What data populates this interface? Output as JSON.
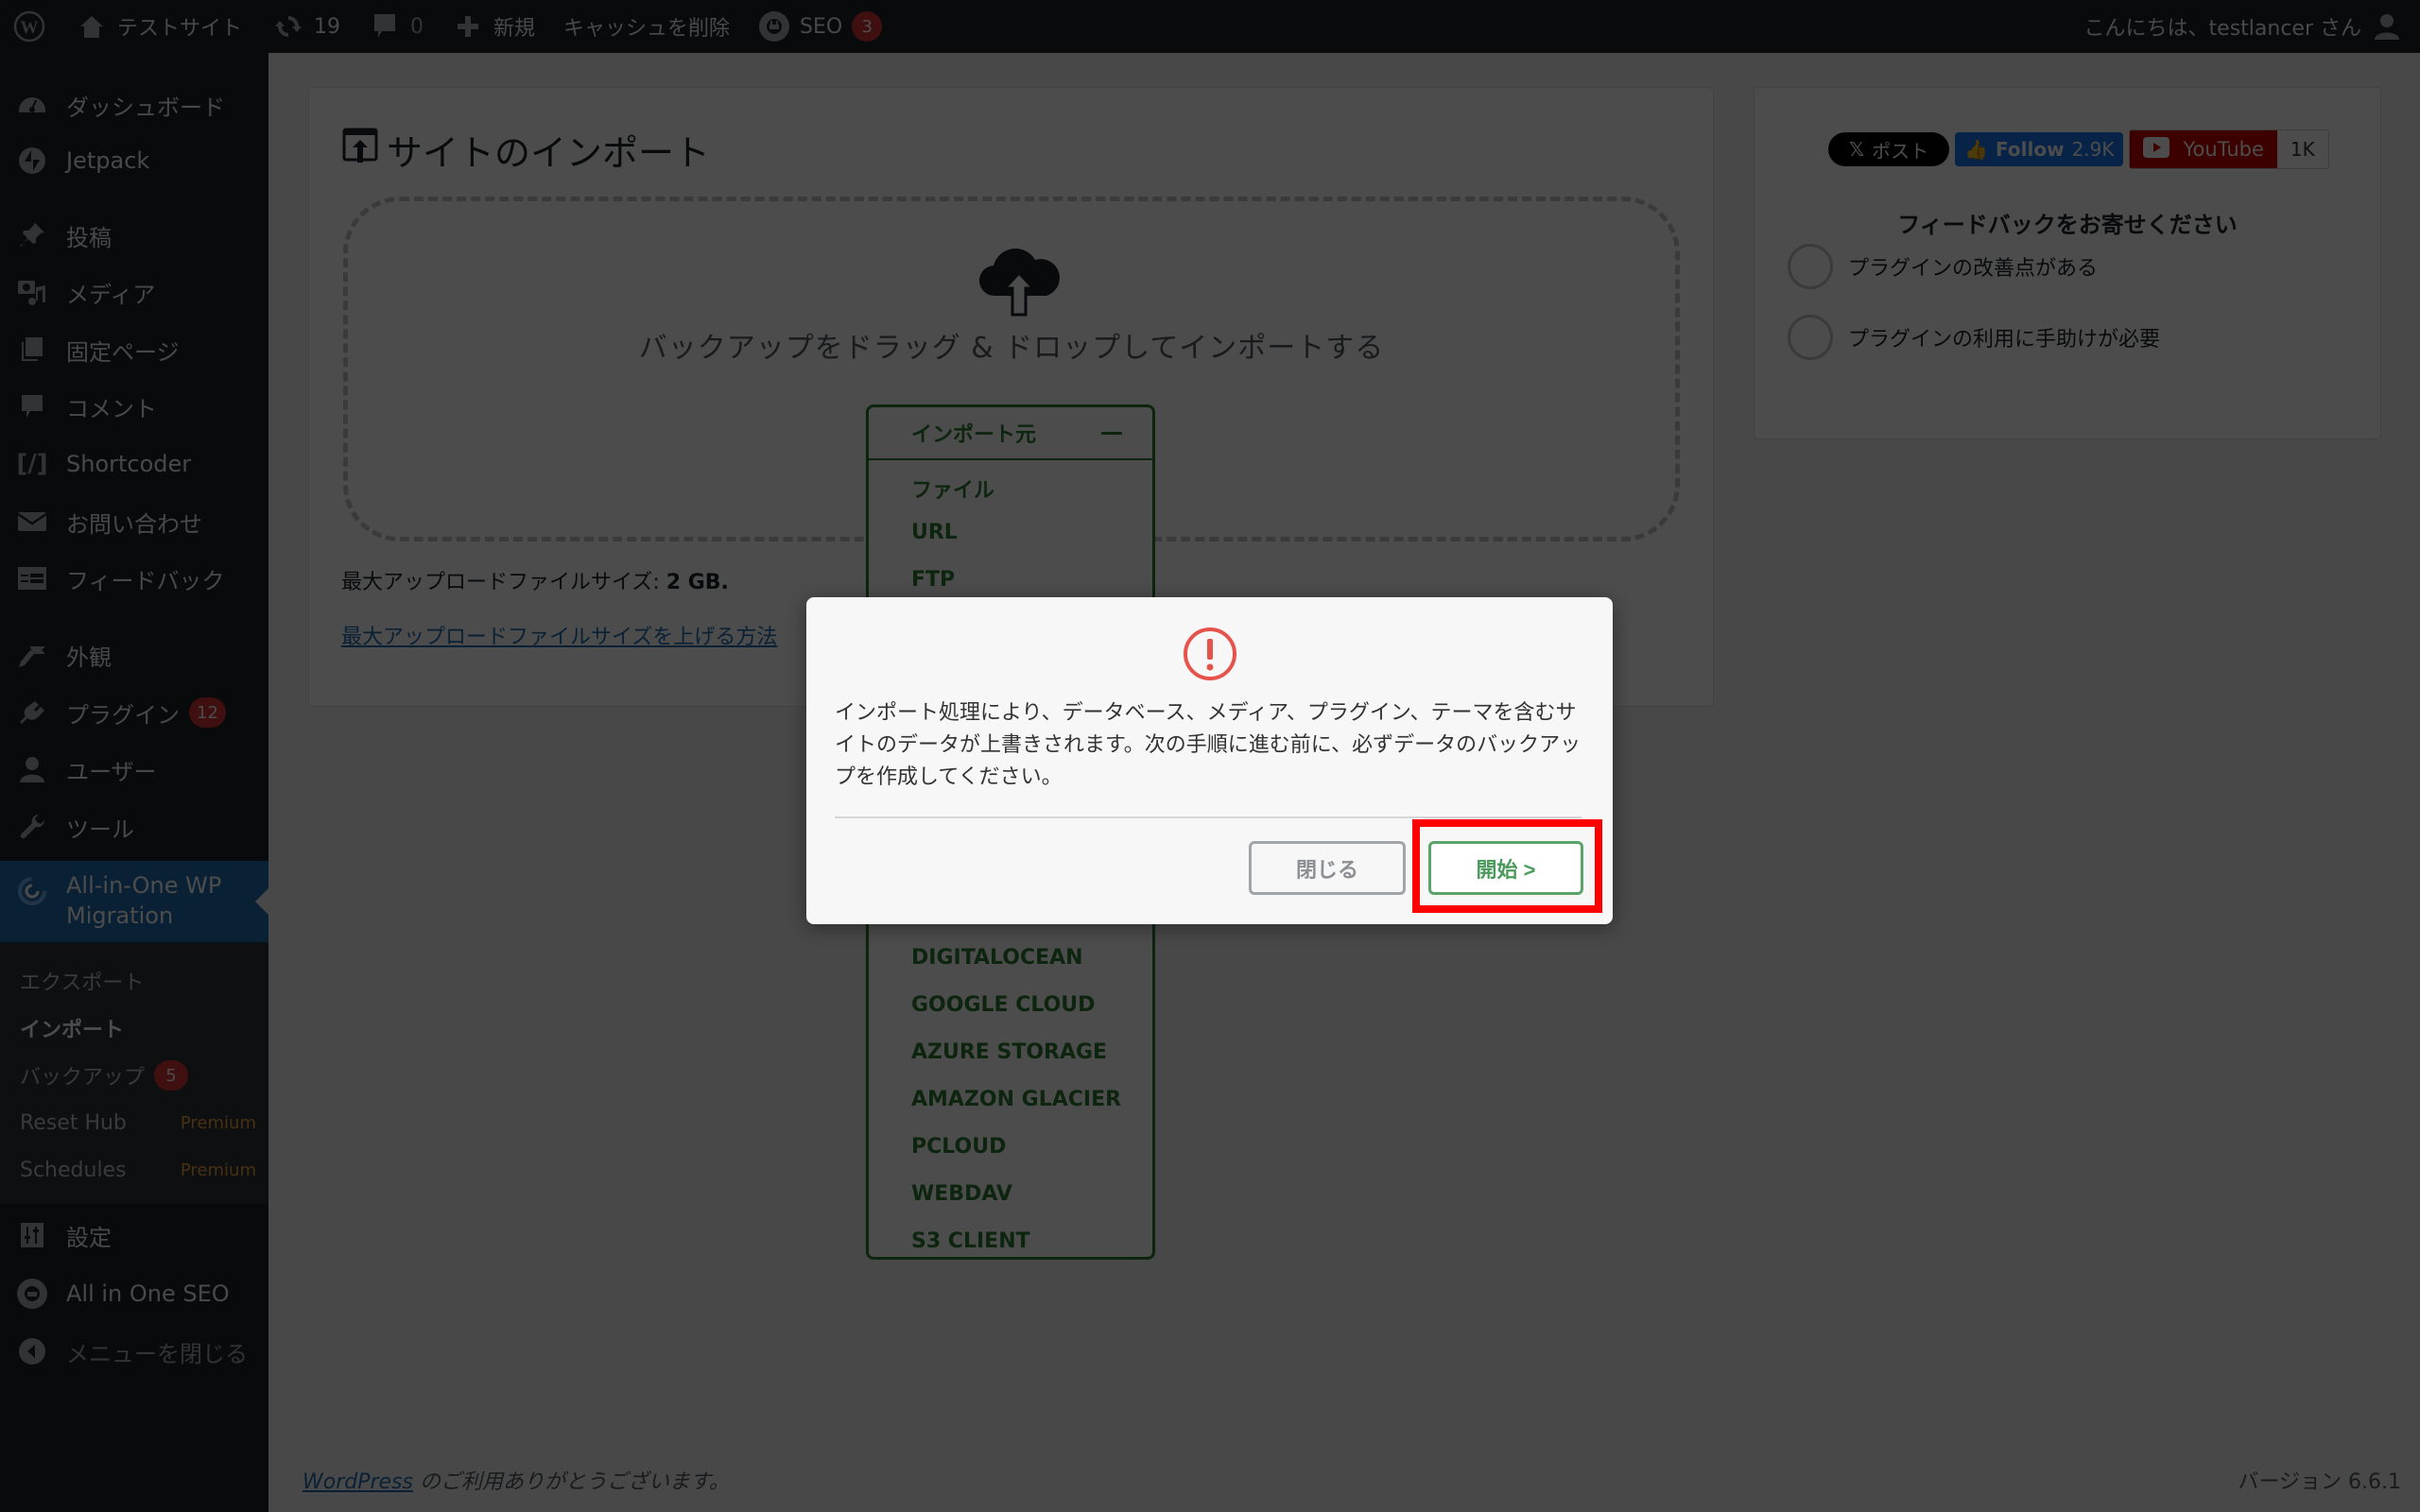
{
  "admin_bar": {
    "site_name": "テストサイト",
    "updates_count": "19",
    "comments_count": "0",
    "new_label": "新規",
    "clear_cache_label": "キャッシュを削除",
    "seo_label": "SEO",
    "seo_badge": "3",
    "greeting": "こんにちは、testlancer さん"
  },
  "sidebar": {
    "items": [
      {
        "label": "ダッシュボード",
        "icon": "dashboard-icon"
      },
      {
        "label": "Jetpack",
        "icon": "jetpack-icon"
      },
      {
        "label": "投稿",
        "icon": "pin-icon"
      },
      {
        "label": "メディア",
        "icon": "media-icon"
      },
      {
        "label": "固定ページ",
        "icon": "pages-icon"
      },
      {
        "label": "コメント",
        "icon": "comment-icon"
      },
      {
        "label": "Shortcoder",
        "icon": "shortcode-icon"
      },
      {
        "label": "お問い合わせ",
        "icon": "mail-icon"
      },
      {
        "label": "フィードバック",
        "icon": "feedback-icon"
      },
      {
        "label": "外観",
        "icon": "brush-icon"
      },
      {
        "label": "プラグイン",
        "icon": "plugin-icon",
        "badge": "12"
      },
      {
        "label": "ユーザー",
        "icon": "user-icon"
      },
      {
        "label": "ツール",
        "icon": "wrench-icon"
      },
      {
        "label": "All-in-One WP Migration",
        "icon": "migration-icon"
      },
      {
        "label": "設定",
        "icon": "settings-icon"
      },
      {
        "label": "All in One SEO",
        "icon": "seo-icon"
      },
      {
        "label": "メニューを閉じる",
        "icon": "collapse-icon"
      }
    ],
    "submenu": [
      {
        "label": "エクスポート"
      },
      {
        "label": "インポート"
      },
      {
        "label": "バックアップ",
        "badge": "5"
      },
      {
        "label": "Reset Hub",
        "tag": "Premium"
      },
      {
        "label": "Schedules",
        "tag": "Premium"
      }
    ]
  },
  "import_panel": {
    "title": "サイトのインポート",
    "drop_text": "バックアップをドラッグ & ドロップしてインポートする",
    "max_size_label": "最大アップロードファイルサイズ: ",
    "max_size_value": "2 GB.",
    "max_size_link": "最大アップロードファイルサイズを上げる方法",
    "source_dropdown": {
      "header": "インポート元",
      "items": [
        "ファイル",
        "URL",
        "FTP",
        "DIGITALOCEAN",
        "GOOGLE CLOUD",
        "AZURE STORAGE",
        "AMAZON GLACIER",
        "PCLOUD",
        "WEBDAV",
        "S3 CLIENT"
      ]
    }
  },
  "side_panel": {
    "x_post_label": "ポスト",
    "fb_follow_label": "Follow",
    "fb_follow_count": "2.9K",
    "youtube_label": "YouTube",
    "youtube_count": "1K",
    "feedback_title": "フィードバックをお寄せください",
    "options": [
      "プラグインの改善点がある",
      "プラグインの利用に手助けが必要"
    ]
  },
  "footer": {
    "wordpress_link": "WordPress",
    "thanks_text": " のご利用ありがとうございます。",
    "version": "バージョン 6.6.1"
  },
  "modal": {
    "message": "インポート処理により、データベース、メディア、プラグイン、テーマを含むサイトのデータが上書きされます。次の手順に進む前に、必ずデータのバックアップを作成してください。",
    "close_label": "閉じる",
    "start_label": "開始 >",
    "warning_color": "#e5534b",
    "start_color": "#5aa469"
  },
  "highlight": {
    "color": "#ff0000",
    "target": "start-button"
  }
}
